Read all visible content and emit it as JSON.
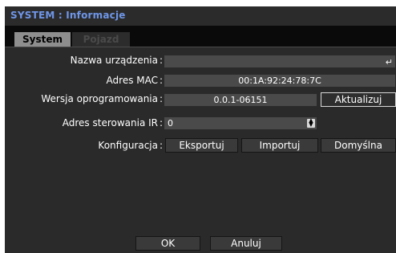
{
  "window": {
    "title": "SYSTEM : Informacje"
  },
  "tabs": [
    {
      "label": "System",
      "active": true
    },
    {
      "label": "Pojazd",
      "active": false
    }
  ],
  "form": {
    "device_name": {
      "label": "Nazwa urządzenia",
      "value": ""
    },
    "mac": {
      "label": "Adres MAC",
      "value": "00:1A:92:24:78:7C"
    },
    "firmware": {
      "label": "Wersja oprogramowania",
      "value": "0.0.1-06151",
      "button": "Aktualizuj"
    },
    "ir": {
      "label": "Adres sterowania IR",
      "value": "0"
    },
    "config": {
      "label": "Konfiguracja",
      "export": "Eksportuj",
      "import": "Importuj",
      "default": "Domyślna"
    }
  },
  "separator": ":",
  "footer": {
    "ok": "OK",
    "cancel": "Anuluj"
  },
  "icons": {
    "enter": "enter-icon",
    "spinner": "spinner-icon"
  },
  "colors": {
    "title": "#6f96e8",
    "panel": "#2a2a2a",
    "field": "#4a4a4a"
  }
}
